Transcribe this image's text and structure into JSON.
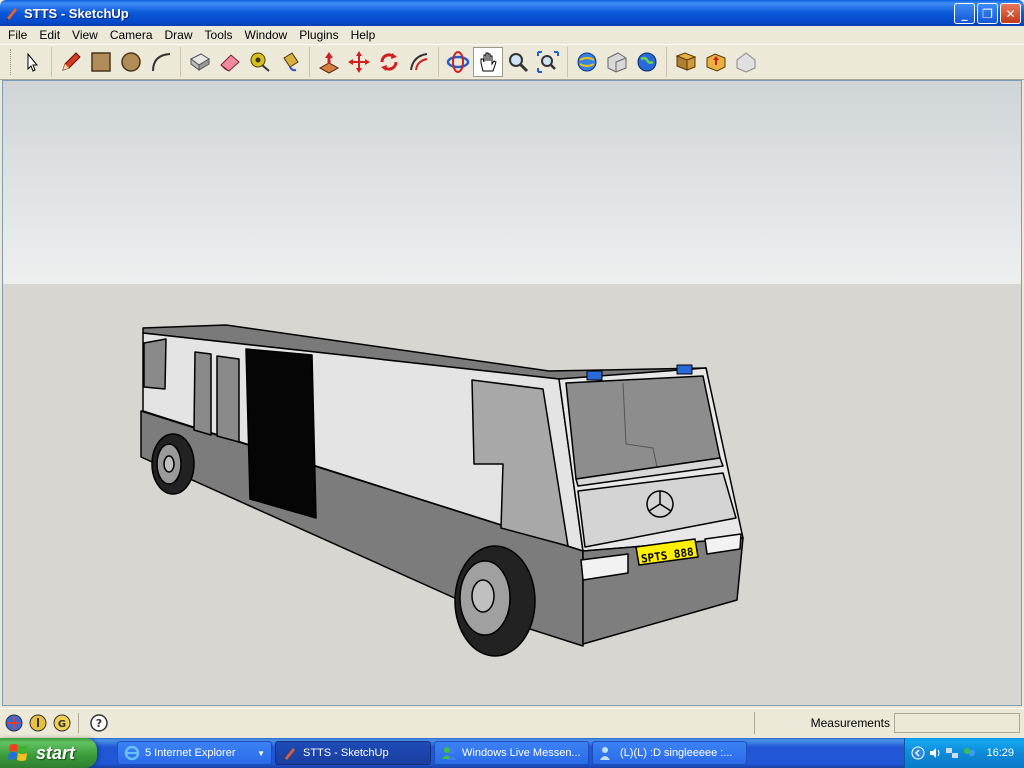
{
  "window": {
    "title": "STTS - SketchUp",
    "controls": {
      "minimize": "_",
      "maximize": "❐",
      "close": "✕"
    }
  },
  "menubar": {
    "items": [
      "File",
      "Edit",
      "View",
      "Camera",
      "Draw",
      "Tools",
      "Window",
      "Plugins",
      "Help"
    ]
  },
  "toolbar": {
    "tools": [
      "select-icon",
      "pencil-icon",
      "rectangle-icon",
      "circle-icon",
      "arc-icon",
      "make-component-icon",
      "eraser-icon",
      "tape-measure-icon",
      "paint-bucket-icon",
      "push-pull-icon",
      "move-icon",
      "rotate-icon",
      "offset-icon",
      "orbit-icon",
      "pan-icon",
      "zoom-icon",
      "zoom-extents-icon",
      "get-models-icon",
      "share-model-icon",
      "google-earth-icon",
      "get-current-view-icon",
      "toggle-terrain-icon",
      "place-model-icon"
    ],
    "active_tool": "pan-icon"
  },
  "scene": {
    "license_plate": "SPTS 888",
    "sky_top_color": "#cfd4d6",
    "sky_bottom_color": "#eef0f0",
    "ground_color": "#d7d6d0"
  },
  "statusbar": {
    "icons": [
      "geo-location-icon",
      "credits-icon",
      "google-sign-in-icon",
      "help-icon"
    ],
    "measurements_label": "Measurements",
    "measurements_value": ""
  },
  "taskbar": {
    "start_label": "start",
    "tasks": [
      {
        "label": "5 Internet Explorer",
        "icon": "ie-icon",
        "active": false,
        "grouped": true
      },
      {
        "label": "STTS - SketchUp",
        "icon": "sketchup-icon",
        "active": true,
        "grouped": false
      },
      {
        "label": "Windows Live Messen...",
        "icon": "messenger-icon",
        "active": false,
        "grouped": false
      },
      {
        "label": "(L)(L) :D singleeeee :...",
        "icon": "chat-icon",
        "active": false,
        "grouped": false
      }
    ],
    "clock": "16:29"
  }
}
